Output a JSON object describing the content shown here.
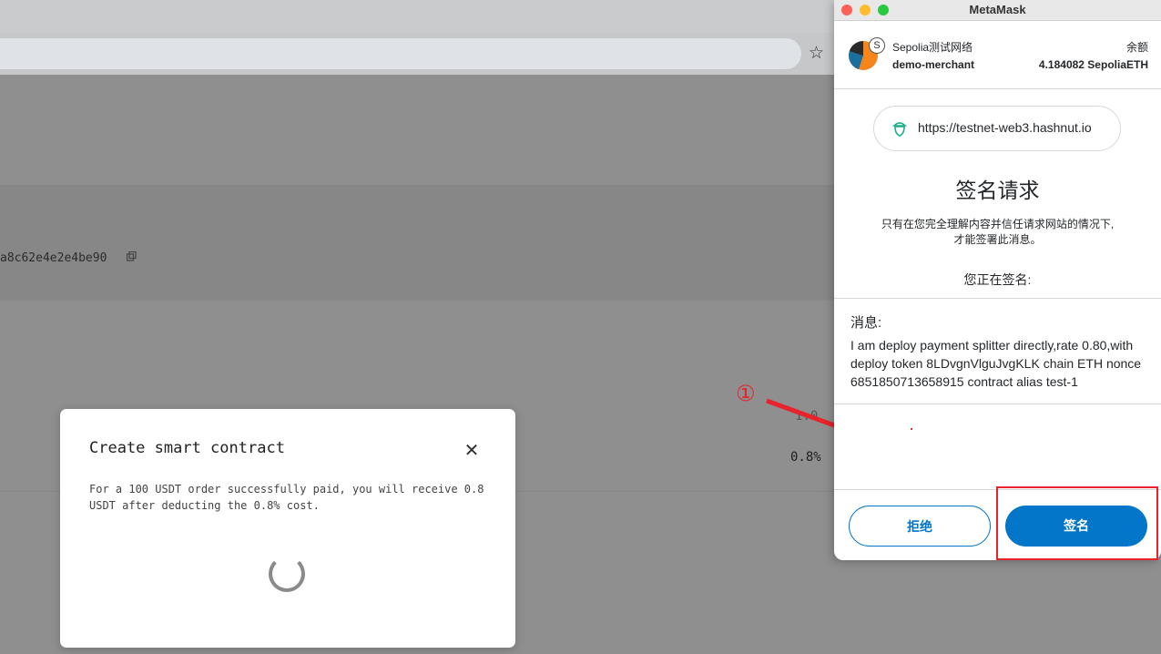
{
  "browser": {
    "bookmark_icon": "star-icon"
  },
  "page": {
    "contract_address_fragment": "a8c62e4e2e4be90",
    "copy_icon": "copy-icon",
    "hidden_value": "1.0",
    "fee_value": "0.8%"
  },
  "modal": {
    "title": "Create smart contract",
    "close_glyph": "✕",
    "description": "For a 100 USDT order successfully paid, you will receive 0.8 USDT after deducting the 0.8% cost.",
    "loading_icon": "spinner-icon"
  },
  "metamask": {
    "window_title": "MetaMask",
    "network_initial": "S",
    "network_name": "Sepolia测试网络",
    "account_name": "demo-merchant",
    "balance_label": "余额",
    "balance_value": "4.184082 SepoliaETH",
    "origin_url": "https://testnet-web3.hashnut.io",
    "heading": "签名请求",
    "warning_line1": "只有在您完全理解内容并信任请求网站的情况下,",
    "warning_line2": "才能签署此消息。",
    "signing_label": "您正在签名:",
    "message_label": "消息:",
    "message_body": "I am deploy payment splitter directly,rate 0.80,with deploy token 8LDvgnVlguJvgKLK chain ETH nonce 6851850713658915 contract alias test-1",
    "reject_label": "拒绝",
    "sign_label": "签名"
  },
  "annotation": {
    "step_marker": "①",
    "color": "#e8232b"
  },
  "colors": {
    "metamask_blue": "#0376c9",
    "origin_icon_green": "#1cb08a"
  }
}
